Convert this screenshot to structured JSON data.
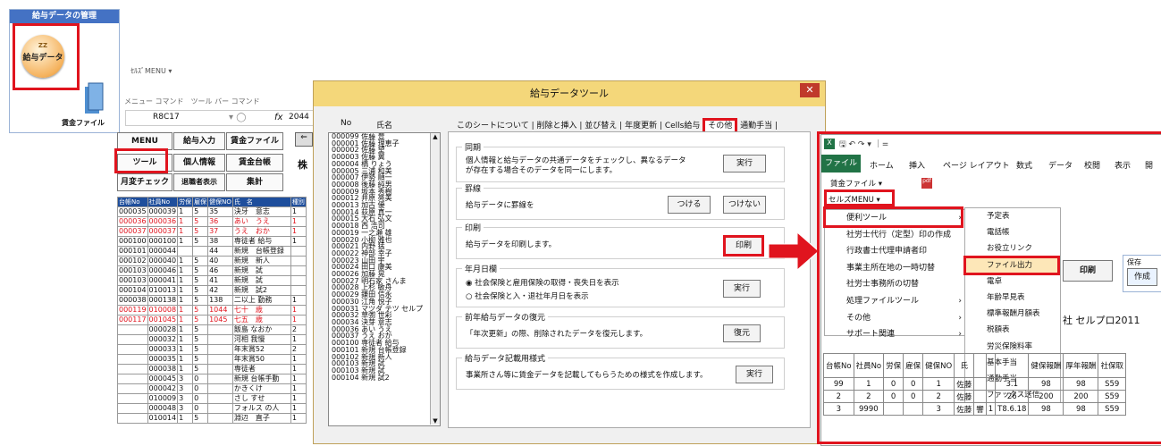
{
  "panel": {
    "header": "給与データの管理",
    "icon_label": "給与データ",
    "icon_mini": "ZZ",
    "file_label": "賃金ファイル"
  },
  "excel_bg": {
    "menu_label": "ｾﾙｽﾞMENU ▾",
    "cmd_labels": "メニュー コマンド　ツール バー コマンド",
    "cell_ref": "R8C17",
    "fx": "fx",
    "fx_value": "2044",
    "buttons": [
      "MENU",
      "給与入力",
      "賃金ファイル",
      "ツール",
      "個人情報",
      "賃金台帳",
      "月変チェック",
      "退職者表示",
      "集計"
    ],
    "stray": "株",
    "headers": [
      "台帳No",
      "社員No",
      "労保",
      "雇保",
      "健保NO",
      "氏　名",
      "種別"
    ],
    "rows": [
      [
        "000035",
        "000039",
        "1",
        "5",
        "35",
        "決牙　意志",
        "1"
      ],
      [
        "000036",
        "000036",
        "1",
        "5",
        "36",
        "あい　うえ",
        "1"
      ],
      [
        "000037",
        "000037",
        "1",
        "5",
        "37",
        "うえ　おか",
        "1"
      ],
      [
        "000100",
        "000100",
        "1",
        "5",
        "38",
        "専徒者 給与",
        "1"
      ],
      [
        "000101",
        "000044",
        "",
        "",
        "44",
        "新規　台帳登録",
        ""
      ],
      [
        "000102",
        "000040",
        "1",
        "5",
        "40",
        "新規　新人",
        ""
      ],
      [
        "000103",
        "000046",
        "1",
        "5",
        "46",
        "新規　試",
        ""
      ],
      [
        "000103",
        "000041",
        "1",
        "5",
        "41",
        "新規　試",
        ""
      ],
      [
        "000104",
        "010013",
        "1",
        "5",
        "42",
        "新規　試2",
        ""
      ],
      [
        "000038",
        "000138",
        "1",
        "5",
        "138",
        "二以上 勤務",
        "1"
      ],
      [
        "000119",
        "010008",
        "1",
        "5",
        "1044",
        "七十　歳",
        "1"
      ],
      [
        "000117",
        "001045",
        "1",
        "5",
        "1045",
        "七五　歳",
        "1"
      ],
      [
        "",
        "000028",
        "1",
        "5",
        "",
        "飯島 なおか",
        "2"
      ],
      [
        "",
        "000032",
        "1",
        "5",
        "",
        "河相 我慢",
        "1"
      ],
      [
        "",
        "000033",
        "1",
        "5",
        "",
        "年末賞52",
        "2"
      ],
      [
        "",
        "000035",
        "1",
        "5",
        "",
        "年末賞50",
        "1"
      ],
      [
        "",
        "000038",
        "1",
        "5",
        "",
        "専徒者",
        "1"
      ],
      [
        "",
        "000045",
        "3",
        "0",
        "",
        "新規 台帳手動",
        "1"
      ],
      [
        "",
        "000042",
        "3",
        "0",
        "",
        "かきくけ",
        "1"
      ],
      [
        "",
        "010009",
        "3",
        "0",
        "",
        "さし すせ",
        "1"
      ],
      [
        "",
        "000048",
        "3",
        "0",
        "",
        "フォルス の人",
        "1"
      ],
      [
        "",
        "010014",
        "1",
        "5",
        "",
        "淵辺　直子",
        "1"
      ]
    ]
  },
  "dialog": {
    "title": "給与データツール",
    "close": "✕",
    "list_headers": [
      "No",
      "氏名"
    ],
    "list": [
      "000099 佐藤 豊",
      "000001 佐藤 理恵子",
      "000002 佐藤 望",
      "000003 佐藤 翼",
      "000004 橋 りょう",
      "000005 三浦 和美",
      "000007 伊勢 順一",
      "000008 後藤 純男",
      "000009 坂本 秀樹",
      "000012 井原 亮美",
      "000013 加古 優",
      "000014 荻原 真一",
      "000015 大石 弘文",
      "000018 西 浩司",
      "000019 一之瀬 雄",
      "000020 小柳 雅也",
      "000021 内野 猛",
      "000022 神部 幸子",
      "000023 山田 宇",
      "000024 田口 康美",
      "000026 加藤 晃",
      "000027 明石家 さんま",
      "000028 上杉 敏舟",
      "000029 鎌田 信永",
      "000030 江角 悦子",
      "000031 マツダ テツ セルプ",
      "000032 草彅 世彩",
      "000034 決芽 意志",
      "000036 あい うえ",
      "000037 うえ おか",
      "000100 専徒者 給与",
      "000101 新規 台帳登録",
      "000102 新規 新人",
      "000103 新規 試",
      "000103 新規 試",
      "000104 新規 試2"
    ],
    "tabs": [
      "このシートについて",
      "削除と挿入",
      "並び替え",
      "年度更新",
      "Cells給与",
      "その他",
      "通勤手当"
    ],
    "groups": [
      {
        "title": "同期",
        "desc": "個人情報と給与データの共通データをチェックし、異なるデータ",
        "desc2": "が存在する場合そのデータを同一にします。",
        "btn": "実行"
      },
      {
        "title": "罫線",
        "desc": "給与データに罫線を",
        "btn": "つける",
        "btn2": "つけない"
      },
      {
        "title": "印刷",
        "desc": "給与データを印刷します。",
        "btn": "印刷"
      },
      {
        "title": "年月日欄",
        "opt1": "社会保険と雇用保険の取得・喪失日を表示",
        "opt2": "社会保険と入・退社年月日を表示",
        "btn": "実行"
      },
      {
        "title": "前年給与データの復元",
        "desc": "「年次更新」の際、削除されたデータを復元します。",
        "btn": "復元"
      },
      {
        "title": "給与データ記載用様式",
        "desc": "事業所さん等に賃金データを記載してもらうための様式を作成します。",
        "btn": "実行"
      }
    ]
  },
  "xl": {
    "quick": "🖫 ↶ ↷ ▾ ｜=",
    "ribbon": [
      "ファイル",
      "ホーム",
      "挿入",
      "ページ レイアウト",
      "数式",
      "データ",
      "校閲",
      "表示",
      "開"
    ],
    "chingin": "賃金ファイル ▾",
    "menu_btn": "セルズMENU ▾",
    "main_menu": [
      "便利ツール",
      "社労士代行（定型）印の作成",
      "行政書士代理申請者印",
      "事業主所在地の一時切替",
      "社労士事務所の切替",
      "処理ファイルツール",
      "その他",
      "サポート関連"
    ],
    "sub_menu": [
      "予定表",
      "電話帳",
      "お役立リンク",
      "ファイル出力",
      "電卓",
      "年齢早見表",
      "標準報酬月額表",
      "税額表",
      "労災保険料率",
      "基本手当",
      "通勤手当",
      "ファックス送信"
    ],
    "print_btn": "印刷",
    "save_label": "保存",
    "create_btn": "作成",
    "company": "社 セルプロ2011",
    "table_headers": [
      "台帳No",
      "社員No",
      "労保",
      "雇保",
      "健保NO",
      "氏",
      "",
      "",
      "",
      "健保報酬",
      "厚年報酬",
      "社保取"
    ],
    "table_rows": [
      [
        "99",
        "1",
        "0",
        "0",
        "1",
        "佐藤",
        "",
        "",
        "3.1",
        "98",
        "98",
        "S59"
      ],
      [
        "2",
        "2",
        "0",
        "0",
        "2",
        "佐藤",
        "",
        "",
        "26",
        "200",
        "200",
        "S59"
      ],
      [
        "3",
        "9990",
        "",
        "",
        "3",
        "佐藤",
        "響",
        "1",
        "T8.6.18",
        "98",
        "98",
        "S59"
      ]
    ]
  },
  "colors": {
    "red": "#e0141e",
    "excel_green": "#217346",
    "dialog_title": "#f4d77a"
  }
}
